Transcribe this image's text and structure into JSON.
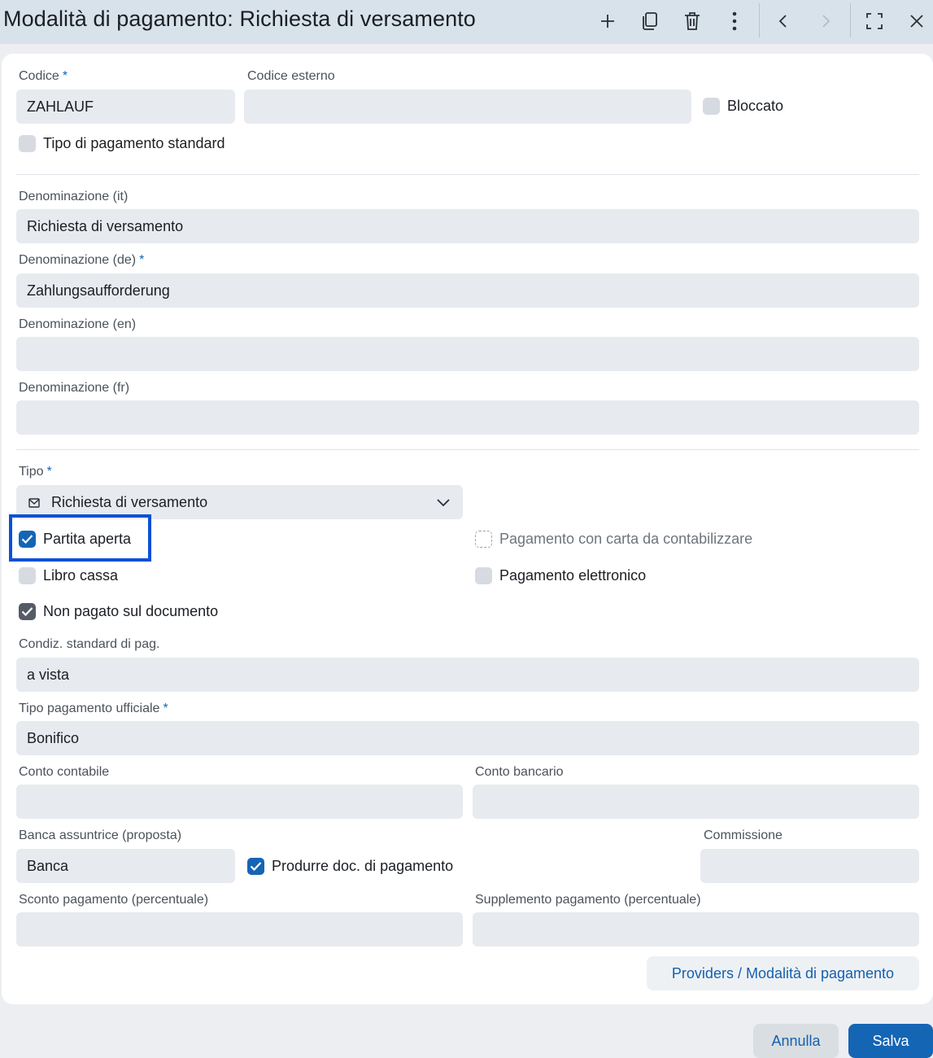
{
  "header": {
    "title": "Modalità di pagamento: Richiesta di versamento",
    "icons": [
      "plus-icon",
      "copy-icon",
      "trash-icon",
      "more-vertical-icon",
      "chevron-left-icon",
      "chevron-right-icon",
      "fullscreen-icon",
      "close-icon"
    ]
  },
  "form": {
    "codice": {
      "label": "Codice",
      "required": "*",
      "value": "ZAHLAUF"
    },
    "codice_esterno": {
      "label": "Codice esterno",
      "value": ""
    },
    "bloccato": {
      "label": "Bloccato",
      "checked": false
    },
    "tipo_standard": {
      "label": "Tipo di pagamento standard",
      "checked": false
    },
    "den_it": {
      "label": "Denominazione (it)",
      "value": "Richiesta di versamento"
    },
    "den_de": {
      "label": "Denominazione (de)",
      "required": "*",
      "value": "Zahlungsaufforderung"
    },
    "den_en": {
      "label": "Denominazione (en)",
      "value": ""
    },
    "den_fr": {
      "label": "Denominazione (fr)",
      "value": ""
    },
    "tipo": {
      "label": "Tipo",
      "required": "*",
      "value": "Richiesta di versamento",
      "icon": "envelope-icon"
    },
    "partita_aperta": {
      "label": "Partita aperta",
      "checked": true
    },
    "pagamento_carta": {
      "label": "Pagamento con carta da contabilizzare",
      "checked": false,
      "disabled": true
    },
    "libro_cassa": {
      "label": "Libro cassa",
      "checked": false
    },
    "pagamento_elettronico": {
      "label": "Pagamento elettronico",
      "checked": false
    },
    "non_pagato": {
      "label": "Non pagato sul documento",
      "checked": true
    },
    "condiz": {
      "label": "Condiz. standard di pag.",
      "value": "a vista"
    },
    "tipo_ufficiale": {
      "label": "Tipo pagamento ufficiale",
      "required": "*",
      "value": "Bonifico"
    },
    "conto_contabile": {
      "label": "Conto contabile",
      "value": ""
    },
    "conto_bancario": {
      "label": "Conto bancario",
      "value": ""
    },
    "banca": {
      "label": "Banca assuntrice (proposta)",
      "value": "Banca"
    },
    "produrre_doc": {
      "label": "Produrre doc. di pagamento",
      "checked": true
    },
    "commissione": {
      "label": "Commissione",
      "value": ""
    },
    "sconto": {
      "label": "Sconto pagamento (percentuale)",
      "value": ""
    },
    "supplemento": {
      "label": "Supplemento pagamento (percentuale)",
      "value": ""
    },
    "providers_link": "Providers / Modalità di pagamento"
  },
  "footer": {
    "cancel_label": "Annulla",
    "save_label": "Salva"
  },
  "colors": {
    "accent": "#1565b5",
    "highlight": "#0a51d6",
    "field_bg": "#e7eaee",
    "titlebar_bg": "#d8e2ea"
  }
}
